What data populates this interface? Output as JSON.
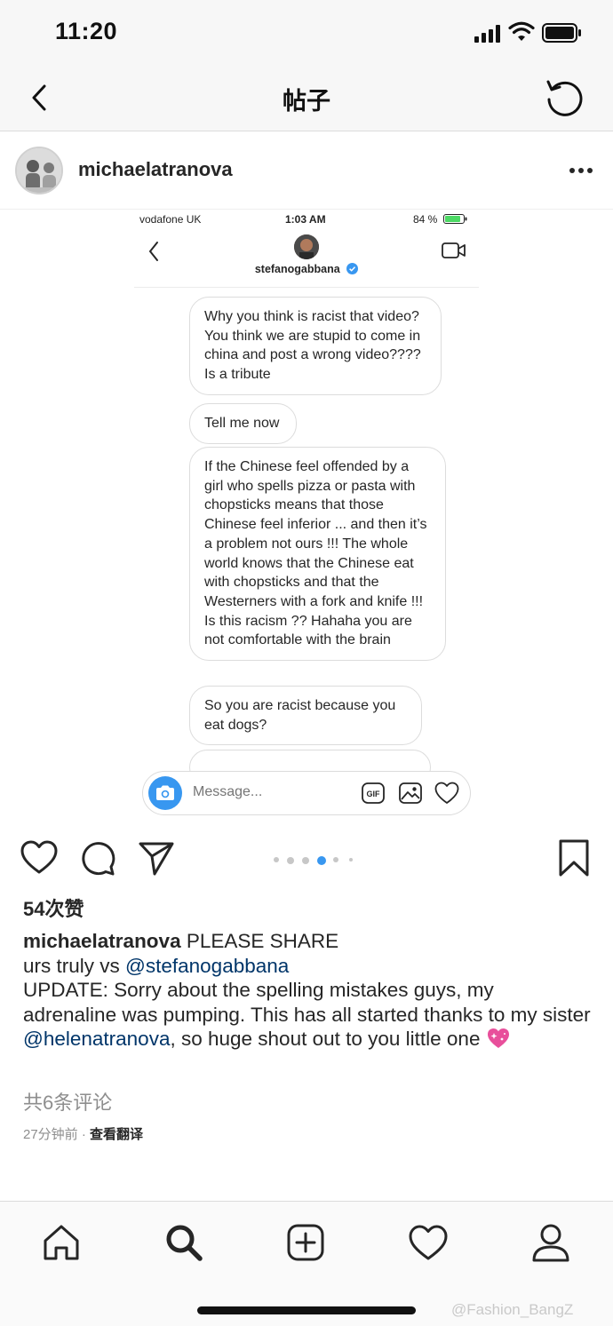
{
  "status_bar": {
    "time": "11:20"
  },
  "nav": {
    "title": "帖子"
  },
  "post": {
    "username": "michaelatranova"
  },
  "screenshot": {
    "status": {
      "carrier": "vodafone UK",
      "time": "1:03 AM",
      "battery": "84 %"
    },
    "contact_name": "stefanogabbana",
    "messages": [
      "Why you think is racist that video? You think we are stupid to come in china and post a wrong video???? Is a tribute",
      "Tell me now",
      "If the Chinese feel offended by a girl who spells pizza or pasta with chopsticks means that those Chinese feel inferior ... and then it’s a problem not ours  !!! The whole world knows that the Chinese eat with chopsticks and that the Westerners with a fork and knife !!! Is this racism ?? Hahaha you are not comfortable with the brain",
      "So you are racist because you eat dogs?",
      "... ... ... ..."
    ],
    "composer_placeholder": "Message...",
    "gif_label": "GIF"
  },
  "carousel": {
    "count": 6,
    "active_index": 3
  },
  "likes": "54次赞",
  "caption": {
    "username": "michaelatranova",
    "line1": " PLEASE SHARE",
    "line2_prefix": "urs truly vs ",
    "mention1": "@stefanogabbana",
    "line3_prefix": "UPDATE: Sorry about the spelling mistakes guys, my adrenaline was pumping. This has all started thanks to my sister ",
    "mention2": "@helenatranova",
    "line3_suffix": ", so huge shout out to you little one "
  },
  "comments_link": "共6条评论",
  "meta": {
    "time_ago": "27分钟前",
    "separator": " · ",
    "translate": "查看翻译"
  },
  "watermark": "@Fashion_BangZ",
  "colors": {
    "accent": "#3897f0",
    "mention": "#003569",
    "muted": "#8e8e8e",
    "text": "#262626"
  }
}
